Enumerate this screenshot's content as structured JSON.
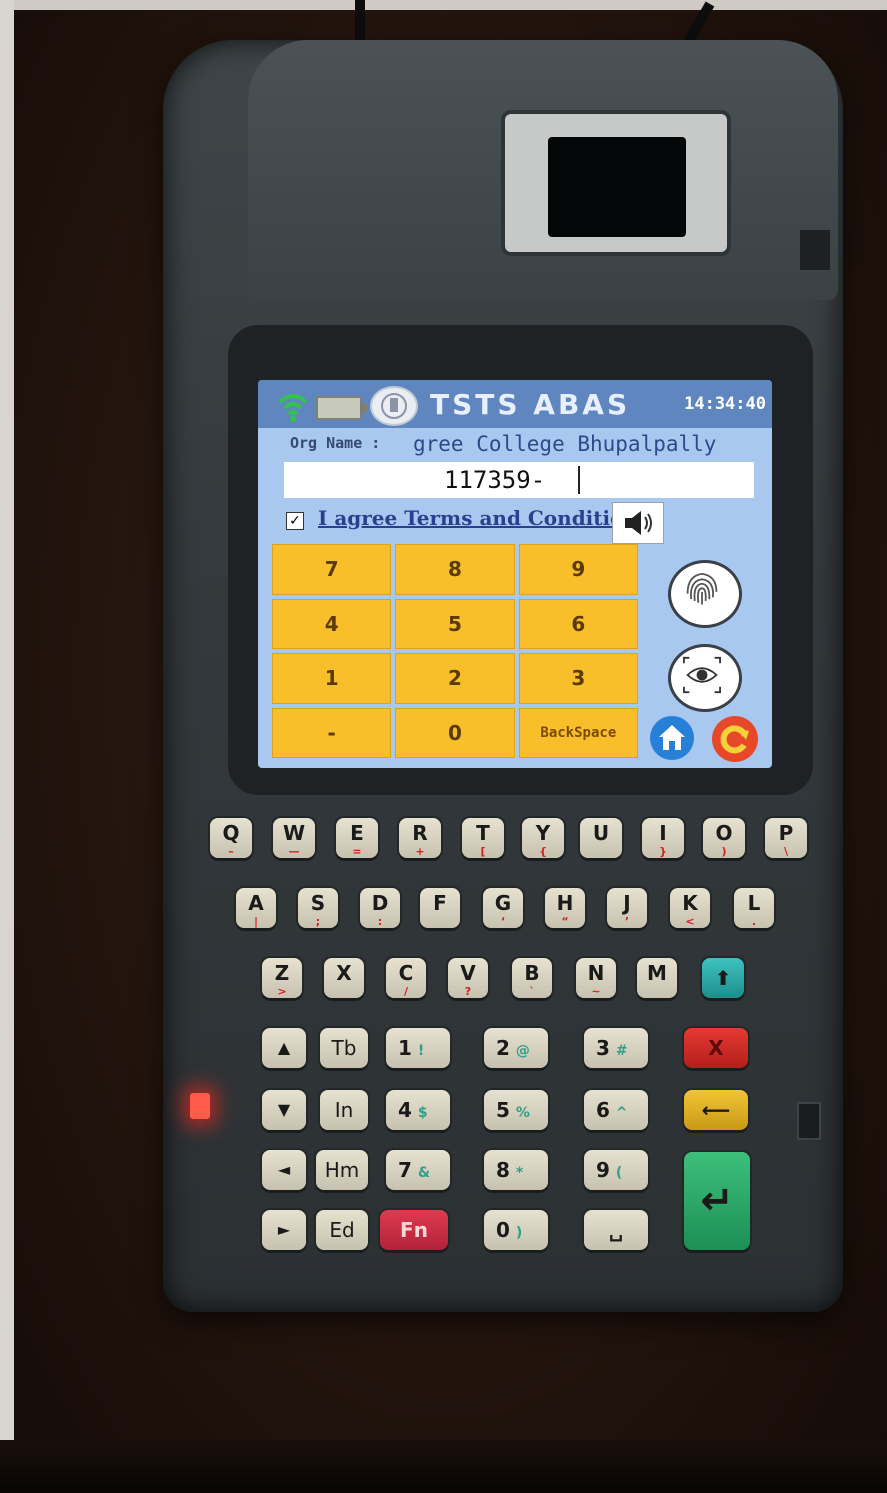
{
  "status_bar": {
    "app_title": "TSTS ABAS",
    "clock": "14:34:40"
  },
  "org": {
    "label": "Org Name :",
    "value": "gree College Bhupalpally"
  },
  "id_input": {
    "value": "117359-"
  },
  "terms": {
    "checked": true,
    "check_mark": "✓",
    "label": "I agree Terms and Conditions"
  },
  "keypad": {
    "keys": [
      "7",
      "8",
      "9",
      "4",
      "5",
      "6",
      "1",
      "2",
      "3",
      "-",
      "0",
      "BackSpace"
    ]
  },
  "hardware_keyboard": {
    "row1": [
      {
        "main": "Q",
        "sub": "–"
      },
      {
        "main": "W",
        "sub": "—"
      },
      {
        "main": "E",
        "sub": "="
      },
      {
        "main": "R",
        "sub": "+"
      },
      {
        "main": "T",
        "sub": "["
      },
      {
        "main": "Y",
        "sub": "{"
      },
      {
        "main": "U",
        "sub": ""
      },
      {
        "main": "I",
        "sub": "}"
      },
      {
        "main": "O",
        "sub": ")"
      },
      {
        "main": "P",
        "sub": "\\"
      }
    ],
    "row2": [
      {
        "main": "A",
        "sub": "|"
      },
      {
        "main": "S",
        "sub": ";"
      },
      {
        "main": "D",
        "sub": ":"
      },
      {
        "main": "F",
        "sub": ""
      },
      {
        "main": "G",
        "sub": "‘"
      },
      {
        "main": "H",
        "sub": "“"
      },
      {
        "main": "J",
        "sub": "’"
      },
      {
        "main": "K",
        "sub": "<"
      },
      {
        "main": "L",
        "sub": "."
      }
    ],
    "row3": [
      {
        "main": "Z",
        "sub": ">"
      },
      {
        "main": "X",
        "sub": ""
      },
      {
        "main": "C",
        "sub": "/"
      },
      {
        "main": "V",
        "sub": "?"
      },
      {
        "main": "B",
        "sub": "`"
      },
      {
        "main": "N",
        "sub": "~"
      },
      {
        "main": "M",
        "sub": ""
      }
    ],
    "nav_labels": [
      "Tb",
      "In",
      "Hm",
      "Ed"
    ],
    "nav_arrows": [
      "▲",
      "▼",
      "◄",
      "►"
    ],
    "fn_label": "Fn",
    "numbers": [
      {
        "main": "1",
        "sym": "!"
      },
      {
        "main": "2",
        "sym": "@"
      },
      {
        "main": "3",
        "sym": "#"
      },
      {
        "main": "4",
        "sym": "$"
      },
      {
        "main": "5",
        "sym": "%"
      },
      {
        "main": "6",
        "sym": "^"
      },
      {
        "main": "7",
        "sym": "&"
      },
      {
        "main": "8",
        "sym": "*"
      },
      {
        "main": "9",
        "sym": "("
      },
      {
        "main": "0",
        "sym": ")"
      }
    ],
    "cancel_label": "X",
    "shift_icon": "⬆",
    "backspace_icon": "⟵",
    "enter_icon": "↵",
    "space_icon": "␣"
  },
  "colors": {
    "screen_bg": "#a9c8ef",
    "keypad_key": "#f8bf2a",
    "cancel_key": "#c42a24",
    "enter_key": "#2aa868",
    "led": "#ff3b30"
  }
}
